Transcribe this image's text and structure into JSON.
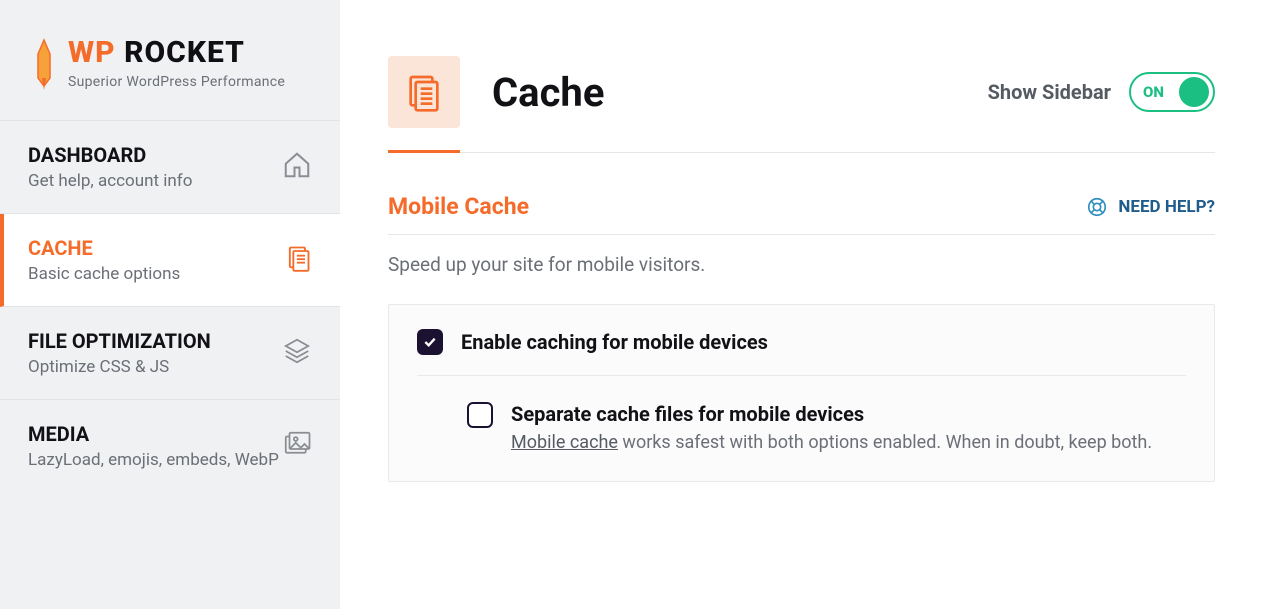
{
  "logo": {
    "prefix": "WP",
    "suffix": " ROCKET",
    "tagline": "Superior WordPress Performance"
  },
  "nav": [
    {
      "title": "DASHBOARD",
      "sub": "Get help, account info",
      "icon": "home-icon",
      "active": false
    },
    {
      "title": "CACHE",
      "sub": "Basic cache options",
      "icon": "doc-icon",
      "active": true
    },
    {
      "title": "FILE OPTIMIZATION",
      "sub": "Optimize CSS & JS",
      "icon": "layers-icon",
      "active": false
    },
    {
      "title": "MEDIA",
      "sub": "LazyLoad, emojis, embeds, WebP",
      "icon": "image-icon",
      "active": false
    }
  ],
  "header": {
    "title": "Cache",
    "show_sidebar_label": "Show Sidebar",
    "toggle_state": "ON"
  },
  "section": {
    "title": "Mobile Cache",
    "help_label": "NEED HELP?",
    "description": "Speed up your site for mobile visitors.",
    "opt1_label": "Enable caching for mobile devices",
    "opt1_checked": true,
    "opt2_label": "Separate cache files for mobile devices",
    "opt2_checked": false,
    "opt2_help_link": "Mobile cache",
    "opt2_help_rest": " works safest with both options enabled. When in doubt, keep both."
  }
}
